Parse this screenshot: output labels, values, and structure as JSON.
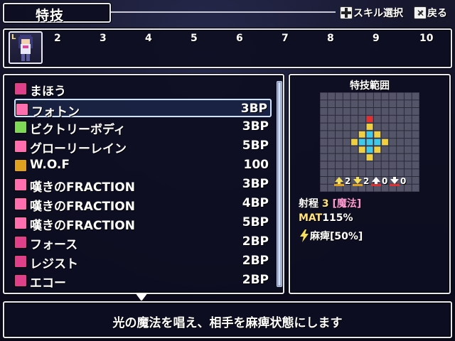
{
  "header": {
    "title": "特技",
    "hint_select": "スキル選択",
    "hint_back": "戻る"
  },
  "party": {
    "active_slot": "L",
    "slots": [
      "2",
      "3",
      "4",
      "5",
      "6",
      "7",
      "8",
      "9",
      "10"
    ]
  },
  "skills": [
    {
      "name": "まほう",
      "cost": "",
      "icon": "magic-category-icon",
      "color": "#e0408a"
    },
    {
      "name": "フォトン",
      "cost": "3BP",
      "icon": "light-magic-icon",
      "color": "#ff6fb0",
      "selected": true
    },
    {
      "name": "ビクトリーボディ",
      "cost": "3BP",
      "icon": "buff-plus-icon",
      "color": "#7ed957"
    },
    {
      "name": "グローリーレイン",
      "cost": "5BP",
      "icon": "light-magic-icon",
      "color": "#ff6fb0"
    },
    {
      "name": "W.O.F",
      "cost": "100",
      "icon": "sun-emblem-icon",
      "color": "#e0a020"
    },
    {
      "name": "嘆きのFRACTION",
      "cost": "3BP",
      "icon": "music-note-icon",
      "color": "#ff6fb0"
    },
    {
      "name": "嘆きのFRACTION",
      "cost": "4BP",
      "icon": "music-note-plus-icon",
      "color": "#ff6fb0"
    },
    {
      "name": "嘆きのFRACTION",
      "cost": "5BP",
      "icon": "music-note-plus2-icon",
      "color": "#ff6fb0"
    },
    {
      "name": "フォース",
      "cost": "2BP",
      "icon": "vo-badge-icon",
      "color": "#e0408a"
    },
    {
      "name": "レジスト",
      "cost": "2BP",
      "icon": "vo-badge-icon",
      "color": "#e0408a"
    },
    {
      "name": "エコー",
      "cost": "2BP",
      "icon": "vo-badge-icon",
      "color": "#e0408a"
    }
  ],
  "range_panel": {
    "title": "特技範囲",
    "overlays": [
      "2",
      "2",
      "0",
      "0"
    ],
    "range_label": "射程",
    "range_value": "3",
    "range_type": "[魔法]",
    "mat_label": "MAT",
    "mat_value": "115%",
    "effect": "麻痺[50%]",
    "colors": {
      "grid_bg": "#55556a",
      "grid_line": "#2a2a38",
      "area": "#f0d040",
      "center": "#e03030",
      "target": "#40c8e8"
    }
  },
  "description": "光の魔法を唱え、相手を麻痺状態にします"
}
